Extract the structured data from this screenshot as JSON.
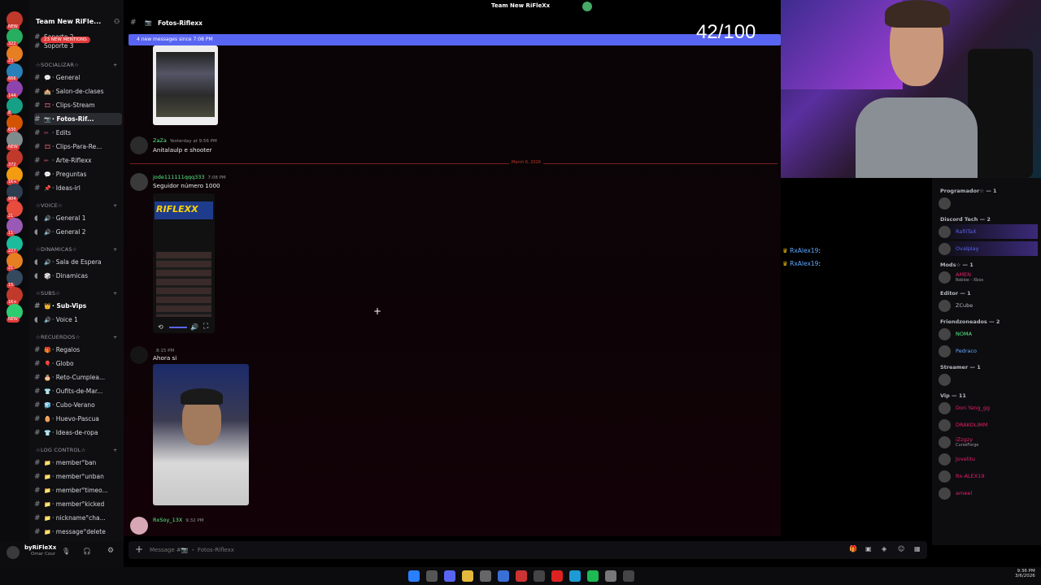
{
  "app": {
    "server_name": "Team New RiFle...",
    "window_title": "Team New RiFleXx"
  },
  "rail": {
    "badges": [
      "NEW",
      "322",
      "23",
      "666",
      "144",
      "8",
      "630",
      "NEW",
      "372",
      "1K+",
      "904",
      "21",
      "11",
      "227",
      "21",
      "15",
      "1K+",
      "NEW"
    ]
  },
  "channels": {
    "top": [
      {
        "label": "Soporte 2"
      },
      {
        "label": "Soporte 3"
      }
    ],
    "mentions_pill": "23 NEW MENTIONS",
    "categories": [
      {
        "label": "☆SOCIALIZAR☆",
        "items": [
          "General",
          "Salon-de-clases",
          "Clips-Stream",
          "Fotos-Rif...",
          "Edits",
          "Clips-Para-Re...",
          "Arte-Riflexx",
          "Preguntas",
          "Ideas-irl"
        ]
      },
      {
        "label": "☆VOICE☆",
        "items": [
          "General 1",
          "General 2"
        ]
      },
      {
        "label": "☆DINAMICAS☆",
        "items": [
          "Sala de Espera",
          "Dinamicas"
        ]
      },
      {
        "label": "☆SUBS☆",
        "items": [
          "Sub-Vips",
          "Voice 1"
        ]
      },
      {
        "label": "☆RECUERDOS☆",
        "items": [
          "Regalos",
          "Globo",
          "Reto-Cumplea...",
          "Oufits-de-Mar...",
          "Cubo-Verano",
          "Huevo-Pascua",
          "Ideas-de-ropa"
        ]
      },
      {
        "label": "☆LOG CONTROL☆",
        "items": [
          "member°ban",
          "member°unban",
          "member°timeo...",
          "member°kicked",
          "nickname°cha...",
          "message°delete"
        ]
      }
    ]
  },
  "user": {
    "name": "byRiFleXx",
    "status": "Omar Cour"
  },
  "header": {
    "channel": "Fotos-Riflexx"
  },
  "banner": {
    "text": "4 new messages since 7:08 PM"
  },
  "counter": "42/100",
  "messages": [
    {
      "author": "ZaZa",
      "time": "Yesterday at 9:56 PM",
      "text": "Anitalaulp e shooter"
    },
    {
      "author": "jode111111qqq333",
      "time": "7:08 PM",
      "text": "Seguidor número 1000"
    },
    {
      "author": "",
      "time": "8:15 PM",
      "text": "Ahora si"
    },
    {
      "author": "RxSoy_13X",
      "time": "9:32 PM",
      "text": ""
    }
  ],
  "date_divider": "March 6, 2026",
  "embed": {
    "title": "RIFLEXX"
  },
  "overlay_chat": [
    {
      "author": "RxAlex19",
      "suffix": ":"
    },
    {
      "author": "RxAlex19",
      "suffix": ":"
    }
  ],
  "composer": {
    "placeholder": "Message #📷 ・ Fotos-Riflexx"
  },
  "members": {
    "groups": [
      {
        "label": "Programador☆ — 1",
        "names": [
          ""
        ]
      },
      {
        "label": "Discord Tech — 2",
        "names": [
          "RafiiTaX",
          "Ovalplay"
        ]
      },
      {
        "label": "Mods☆ — 1",
        "names": [
          "AMEN"
        ]
      },
      {
        "label": "Editor — 1",
        "names": [
          "ZCube"
        ]
      },
      {
        "label": "Friendzoneados — 2",
        "names": [
          "NOMA",
          "Pedraco"
        ]
      },
      {
        "label": "Streamer — 1",
        "names": [
          ""
        ]
      },
      {
        "label": "Vip — 11",
        "names": [
          "Don Yang_gg",
          "DRAKOLIMM",
          "iZzgzy",
          "Jovelitu",
          "Rx-ALEX19",
          "ameel"
        ]
      }
    ],
    "sub_texts": {
      "AMEN": "Roblox - Xbox",
      "iZzgzy": "CurseForge"
    }
  },
  "taskbar": {
    "time": "9:36 PM",
    "date": "3/6/2026"
  },
  "colors": {
    "accent": "#5865f2",
    "green": "#57f287",
    "vip": "#e91e63",
    "red_line": "#c0392b"
  }
}
